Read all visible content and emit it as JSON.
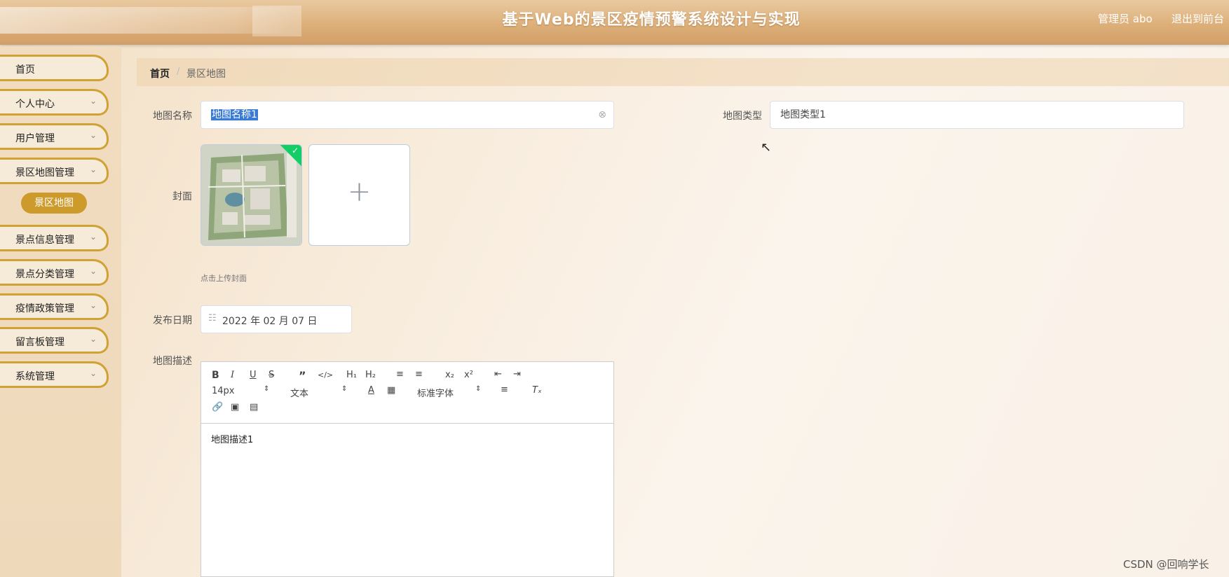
{
  "header": {
    "title": "基于Web的景区疫情预警系统设计与实现",
    "admin_label": "管理员 abo",
    "exit_label": "退出到前台"
  },
  "sidebar": {
    "items": [
      {
        "label": "首页"
      },
      {
        "label": "个人中心"
      },
      {
        "label": "用户管理"
      },
      {
        "label": "景区地图管理"
      },
      {
        "label": "景点信息管理"
      },
      {
        "label": "景点分类管理"
      },
      {
        "label": "疫情政策管理"
      },
      {
        "label": "留言板管理"
      },
      {
        "label": "系统管理"
      }
    ],
    "active_sub": "景区地图"
  },
  "breadcrumb": {
    "home": "首页",
    "separator": "/",
    "current": "景区地图"
  },
  "form": {
    "name_label": "地图名称",
    "name_value": "地图名称1",
    "type_label": "地图类型",
    "type_value": "地图类型1",
    "cover_label": "封面",
    "cover_hint": "点击上传封面",
    "date_label": "发布日期",
    "date_value": "2022 年 02 月 07 日",
    "desc_label": "地图描述",
    "desc_value": "地图描述1"
  },
  "editor": {
    "font_size": "14px",
    "block_format": "文本",
    "font_family": "标准字体",
    "tools": [
      "B",
      "I",
      "U",
      "S",
      "quote",
      "code",
      "H1",
      "H2",
      "ordered-list",
      "bullet-list",
      "subscript",
      "superscript",
      "outdent",
      "indent",
      "font-color",
      "background-color",
      "align",
      "clear-format",
      "link",
      "image",
      "video"
    ]
  },
  "watermark": "CSDN @回响学长",
  "colors": {
    "accent": "#cc9b2c",
    "check": "#13ce66",
    "selection": "#3a7bd5"
  }
}
